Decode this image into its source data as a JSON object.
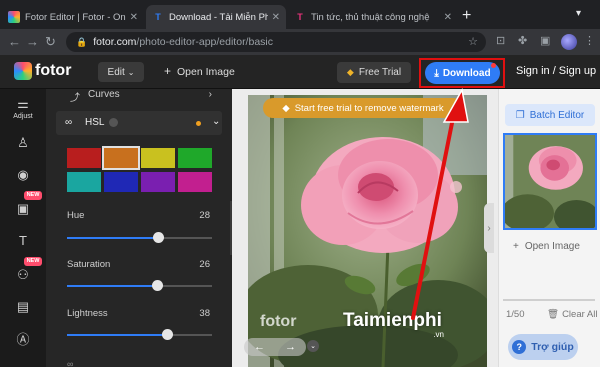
{
  "browser": {
    "tabs": [
      {
        "title": "Fotor Editor | Fotor - Onli",
        "favicon": "fotor-icon",
        "active": false
      },
      {
        "title": "Download - Tải Miễn Phí VI",
        "favicon": "T",
        "active": true
      },
      {
        "title": "Tin tức, thủ thuật công nghệ",
        "favicon": "T",
        "active": false
      }
    ],
    "url_host": "fotor.com",
    "url_path": "/photo-editor-app/editor/basic"
  },
  "header": {
    "logo": "fotor",
    "edit_label": "Edit",
    "open_image_label": "Open Image",
    "free_trial_label": "Free Trial",
    "download_label": "Download",
    "signin_label": "Sign in / Sign up"
  },
  "rail": {
    "adjust_label": "Adjust",
    "new_badge": "NEW"
  },
  "panel": {
    "curves_label": "Curves",
    "hsl_label": "HSL",
    "swatches": [
      "#b81e1e",
      "#c8701e",
      "#c9c11f",
      "#1fa82a",
      "#1aa6a0",
      "#1f28b5",
      "#7a1fb0",
      "#c21f8f"
    ],
    "sliders": [
      {
        "label": "Hue",
        "value": "28",
        "fraction": 0.63
      },
      {
        "label": "Saturation",
        "value": "26",
        "fraction": 0.62
      },
      {
        "label": "Lightness",
        "value": "38",
        "fraction": 0.69
      }
    ]
  },
  "canvas": {
    "banner": "Start free trial to remove watermark",
    "fotor_watermark": "fotor",
    "site_watermark": "Taimienphi",
    "site_watermark_sub": ".vn"
  },
  "right_panel": {
    "batch_label": "Batch Editor",
    "open_image_label": "Open Image",
    "count": "1/50",
    "clear_all_label": "Clear All",
    "help_label": "Trợ giúp"
  },
  "colors": {
    "accent": "#2f7cf6",
    "highlight_frame": "#e01010",
    "annotation_arrow": "#e01010"
  }
}
